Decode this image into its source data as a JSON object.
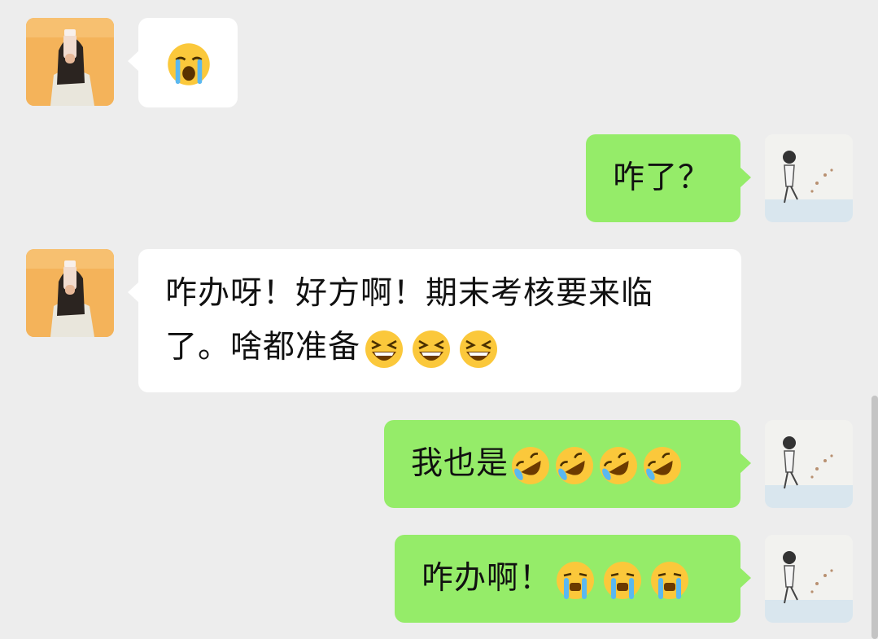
{
  "colors": {
    "background": "#ededed",
    "incoming_bubble": "#ffffff",
    "outgoing_bubble": "#95ec69"
  },
  "messages": [
    {
      "sender": "contact",
      "text": "",
      "emojis": [
        "loudly-crying-face"
      ]
    },
    {
      "sender": "me",
      "text": "咋了？",
      "emojis": []
    },
    {
      "sender": "contact",
      "line1": "咋办呀！好方啊！期末考核要来临",
      "line2": "了。啥都准备",
      "emojis": [
        "grinning-squinting-face",
        "grinning-squinting-face",
        "grinning-squinting-face"
      ]
    },
    {
      "sender": "me",
      "text": "我也是",
      "emojis": [
        "rolling-on-floor-laughing-face",
        "rolling-on-floor-laughing-face",
        "rolling-on-floor-laughing-face",
        "rolling-on-floor-laughing-face"
      ]
    },
    {
      "sender": "me",
      "text": "咋办啊！",
      "emojis": [
        "crying-face",
        "crying-face",
        "crying-face"
      ]
    }
  ]
}
